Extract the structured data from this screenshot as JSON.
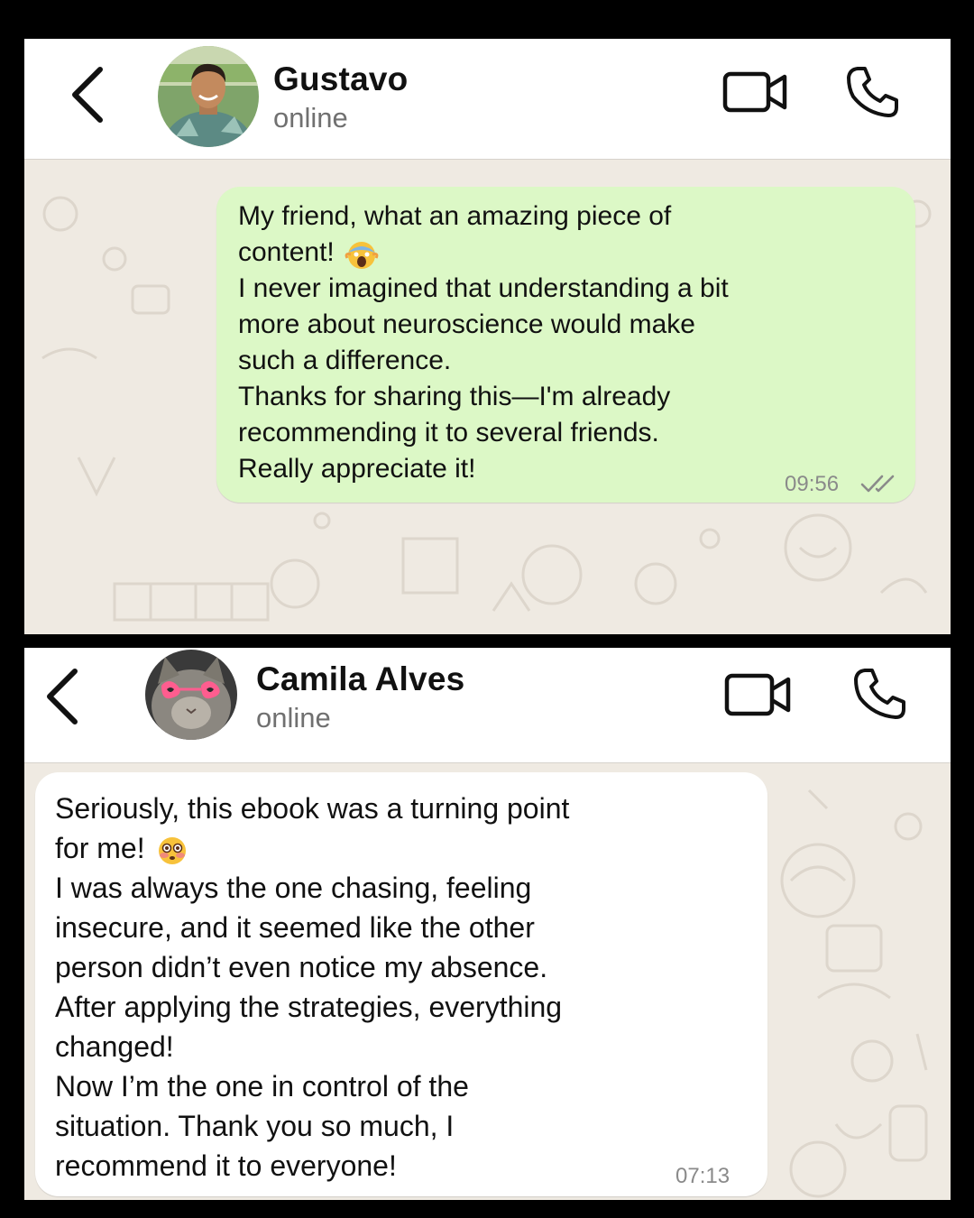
{
  "chats": [
    {
      "contact": {
        "name": "Gustavo",
        "status": "online"
      },
      "message": {
        "direction": "sent",
        "lines": [
          "My friend, what an amazing piece of",
          "content!",
          "I never imagined that understanding a bit",
          "more about neuroscience would make",
          "such a difference.",
          "Thanks for sharing this—I'm already",
          "recommending it to several friends.",
          "Really appreciate it!"
        ],
        "emoji": "face-screaming-in-fear",
        "time": "09:56",
        "read_receipt": "double-check"
      }
    },
    {
      "contact": {
        "name": "Camila Alves",
        "status": "online"
      },
      "message": {
        "direction": "received",
        "lines": [
          "Seriously, this ebook was a turning point",
          "for me!",
          "I was always the one chasing, feeling",
          "insecure, and it seemed like the other",
          "person didn’t even notice my absence.",
          "After applying the strategies, everything",
          "changed!",
          "Now I’m the one in control of the",
          "situation. Thank you so much, I",
          "recommend it to everyone!"
        ],
        "emoji": "flushed-face",
        "time": "07:13"
      }
    }
  ],
  "colors": {
    "sent_bubble": "#dcf8c6",
    "received_bubble": "#ffffff",
    "chat_background": "#efeae2",
    "frame": "#000000"
  },
  "icons": [
    "back-arrow-icon",
    "video-call-icon",
    "voice-call-icon",
    "double-check-icon"
  ]
}
